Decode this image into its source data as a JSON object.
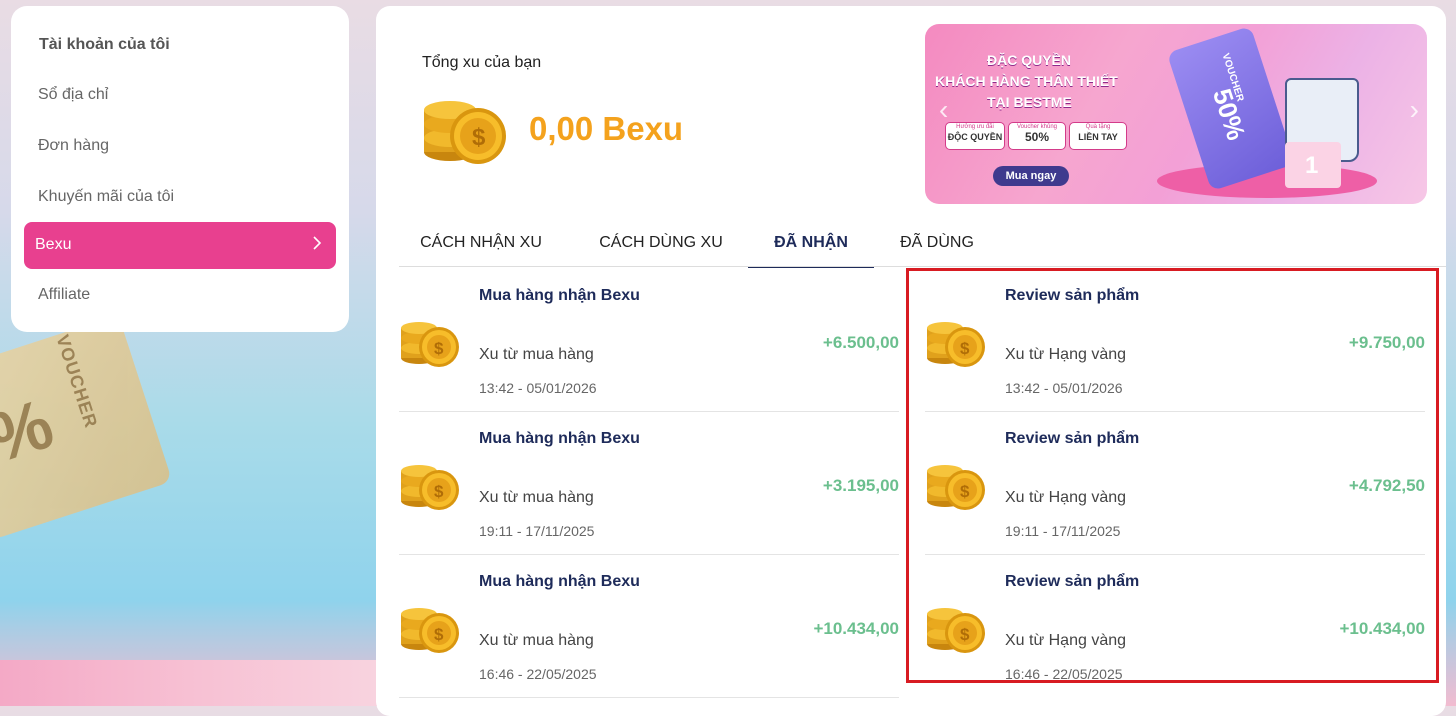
{
  "sidebar": {
    "title": "Tài khoản của tôi",
    "items": [
      {
        "label": "Sổ địa chỉ"
      },
      {
        "label": "Đơn hàng"
      },
      {
        "label": "Khuyến mãi của tôi"
      },
      {
        "label": "Bexu",
        "active": true
      },
      {
        "label": "Affiliate"
      }
    ],
    "active_color": "#e8408f"
  },
  "summary": {
    "label": "Tổng xu của bạn",
    "value": "0,00 Bexu",
    "value_color": "#f4a21d"
  },
  "banner": {
    "line1": "ĐẶC QUYỀN",
    "line2": "KHÁCH HÀNG THÂN THIẾT",
    "line3": "TẠI BESTME",
    "pill1_small": "Hưởng ưu đãi",
    "pill1_big": "ĐỘC QUYỀN",
    "pill2_small": "Voucher khủng",
    "pill2_big": "50%",
    "pill3_small": "Quà tặng",
    "pill3_big": "LIỀN TAY",
    "ticket_label": "VOUCHER",
    "ticket_value": "50%",
    "podium_number": "1",
    "cta": "Mua ngay"
  },
  "tabs": [
    {
      "label": "CÁCH NHẬN XU"
    },
    {
      "label": "CÁCH DÙNG XU"
    },
    {
      "label": "ĐÃ NHẬN",
      "active": true
    },
    {
      "label": "ĐÃ DÙNG"
    }
  ],
  "history_left": [
    {
      "title": "Mua hàng nhận Bexu",
      "sub": "Xu từ mua hàng",
      "time": "13:42 - 05/01/2026",
      "amount": "+6.500,00"
    },
    {
      "title": "Mua hàng nhận Bexu",
      "sub": "Xu từ mua hàng",
      "time": "19:11 - 17/11/2025",
      "amount": "+3.195,00"
    },
    {
      "title": "Mua hàng nhận Bexu",
      "sub": "Xu từ mua hàng",
      "time": "16:46 - 22/05/2025",
      "amount": "+10.434,00"
    }
  ],
  "history_right": [
    {
      "title": "Review sản phẩm",
      "sub": "Xu từ Hạng vàng",
      "time": "13:42 - 05/01/2026",
      "amount": "+9.750,00"
    },
    {
      "title": "Review sản phẩm",
      "sub": "Xu từ Hạng vàng",
      "time": "19:11 - 17/11/2025",
      "amount": "+4.792,50"
    },
    {
      "title": "Review sản phẩm",
      "sub": "Xu từ Hạng vàng",
      "time": "16:46 - 22/05/2025",
      "amount": "+10.434,00"
    }
  ],
  "amount_color": "#6bbf8e",
  "highlight_color": "#d81b22",
  "icons": [
    "coin-stack-icon",
    "chevron-right-icon",
    "chevron-left-icon"
  ]
}
